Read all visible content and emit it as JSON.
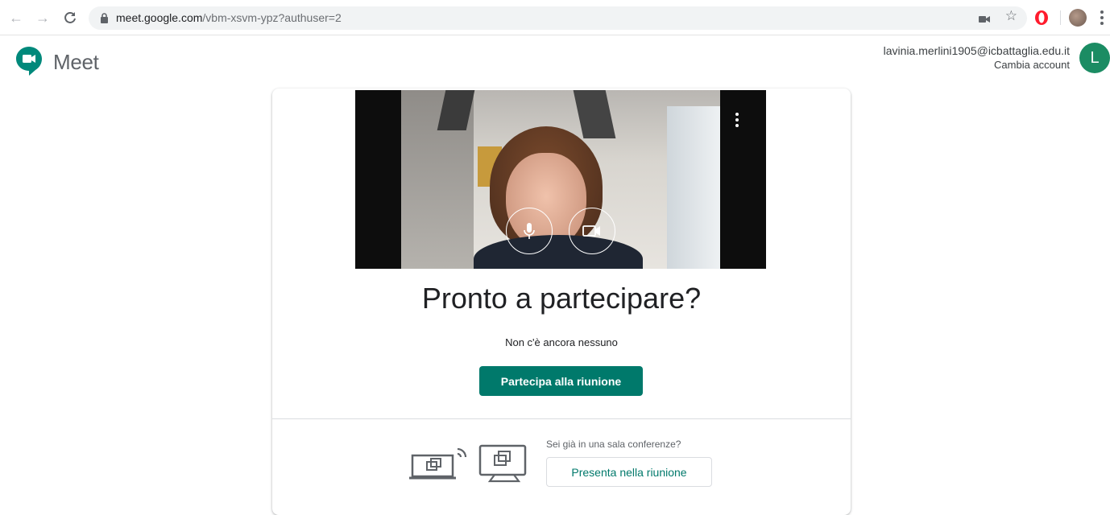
{
  "browser": {
    "url_host": "meet.google.com",
    "url_rest": "/vbm-xsvm-ypz?authuser=2",
    "icons": [
      "back-arrow-icon",
      "forward-arrow-icon",
      "reload-icon",
      "lock-icon",
      "camera-icon",
      "star-icon",
      "opera-icon",
      "profile-picture",
      "kebab-menu-icon"
    ]
  },
  "header": {
    "app_name": "Meet",
    "account_email": "lavinia.merlini1905@icbattaglia.edu.it",
    "switch_account": "Cambia account",
    "avatar_letter": "L"
  },
  "preview": {
    "title": "Pronto a partecipare?",
    "status": "Non c'è ancora nessuno",
    "join_label": "Partecipa alla riunione",
    "room_question": "Sei già in una sala conferenze?",
    "present_label": "Presenta nella riunione"
  },
  "colors": {
    "accent": "#00796b",
    "avatar": "#1b8c63"
  }
}
